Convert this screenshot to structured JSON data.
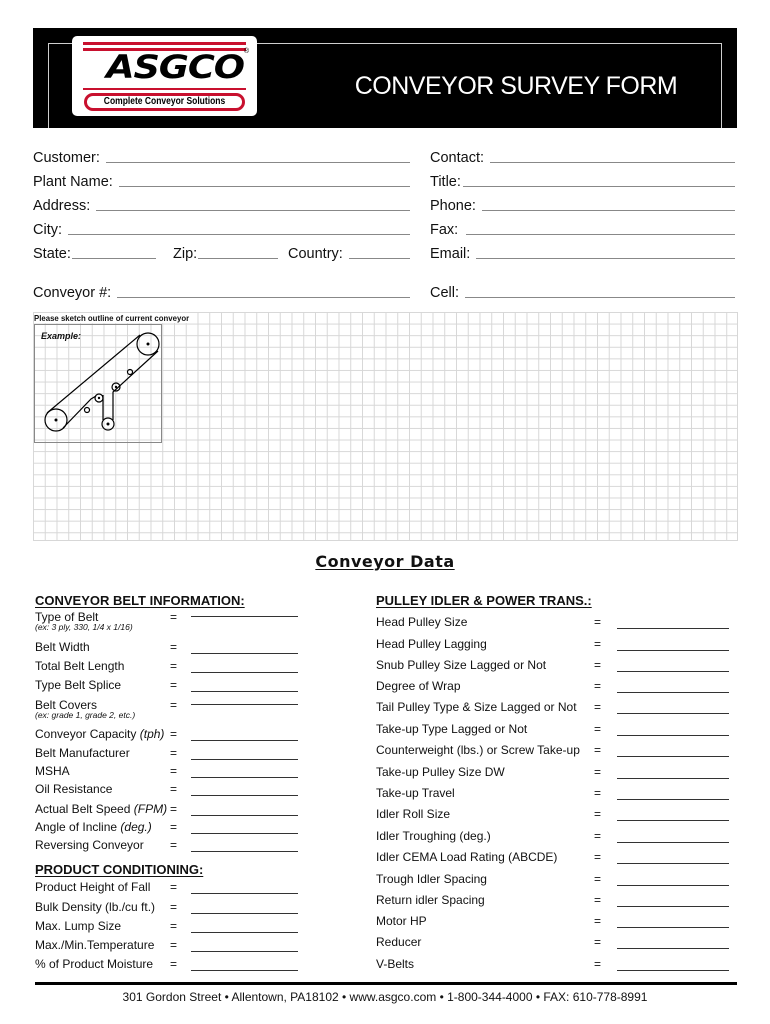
{
  "header": {
    "logo": {
      "wordmark": "ASGCO",
      "registered": "®",
      "tagline": "Complete Conveyor Solutions",
      "accent_color": "#c8102e"
    },
    "title": "CONVEYOR SURVEY FORM"
  },
  "contact_fields": {
    "customer": "Customer:",
    "plant_name": "Plant Name:",
    "address": "Address:",
    "city": "City:",
    "state": "State:",
    "zip": "Zip:",
    "country": "Country:",
    "conveyor_no": "Conveyor #:",
    "contact": "Contact:",
    "title": "Title:",
    "phone": "Phone:",
    "fax": "Fax:",
    "email": "Email:",
    "cell": "Cell:"
  },
  "sketch": {
    "caption": "Please sketch outline of current conveyor",
    "example_label": "Example:"
  },
  "conveyor_data": {
    "title": "Conveyor Data",
    "belt_info": {
      "heading": "CONVEYOR BELT INFORMATION:",
      "items": [
        {
          "label": "Type of Belt",
          "hint": "(ex: 3 ply, 330, 1/4 x 1/16)"
        },
        {
          "label": "Belt Width"
        },
        {
          "label": "Total Belt Length"
        },
        {
          "label": "Type Belt Splice"
        },
        {
          "label": "Belt Covers",
          "hint": "(ex: grade 1, grade 2, etc.)"
        },
        {
          "label": "Conveyor Capacity",
          "unit": "(tph)"
        },
        {
          "label": "Belt Manufacturer"
        },
        {
          "label": "MSHA"
        },
        {
          "label": "Oil Resistance"
        },
        {
          "label": "Actual Belt Speed",
          "unit": "(FPM)"
        },
        {
          "label": "Angle of Incline",
          "unit": "(deg.)"
        },
        {
          "label": "Reversing Conveyor"
        }
      ]
    },
    "product": {
      "heading": "PRODUCT CONDITIONING:",
      "items": [
        {
          "label": "Product Height of Fall"
        },
        {
          "label": "Bulk Density (lb./cu ft.)"
        },
        {
          "label": "Max. Lump Size"
        },
        {
          "label": "Max./Min.Temperature"
        },
        {
          "label": "% of Product Moisture"
        }
      ]
    },
    "pulley": {
      "heading": "PULLEY IDLER & POWER TRANS.:",
      "items": [
        {
          "label": "Head Pulley Size"
        },
        {
          "label": "Head Pulley Lagging"
        },
        {
          "label": "Snub Pulley Size Lagged or Not"
        },
        {
          "label": "Degree of Wrap"
        },
        {
          "label": "Tail Pulley Type & Size Lagged or Not"
        },
        {
          "label": "Take-up Type Lagged or Not"
        },
        {
          "label": "Counterweight (lbs.) or Screw Take-up"
        },
        {
          "label": "Take-up Pulley Size DW"
        },
        {
          "label": "Take-up Travel"
        },
        {
          "label": "Idler Roll Size"
        },
        {
          "label": "Idler Troughing (deg.)"
        },
        {
          "label": "Idler CEMA Load Rating (ABCDE)"
        },
        {
          "label": "Trough Idler Spacing"
        },
        {
          "label": "Return idler Spacing"
        },
        {
          "label": "Motor HP"
        },
        {
          "label": "Reducer"
        },
        {
          "label": "V-Belts"
        }
      ]
    },
    "equals_sign": "="
  },
  "footer": {
    "text": "301 Gordon Street  •  Allentown, PA18102  •  www.asgco.com  •  1-800-344-4000  •  FAX: 610-778-8991"
  }
}
